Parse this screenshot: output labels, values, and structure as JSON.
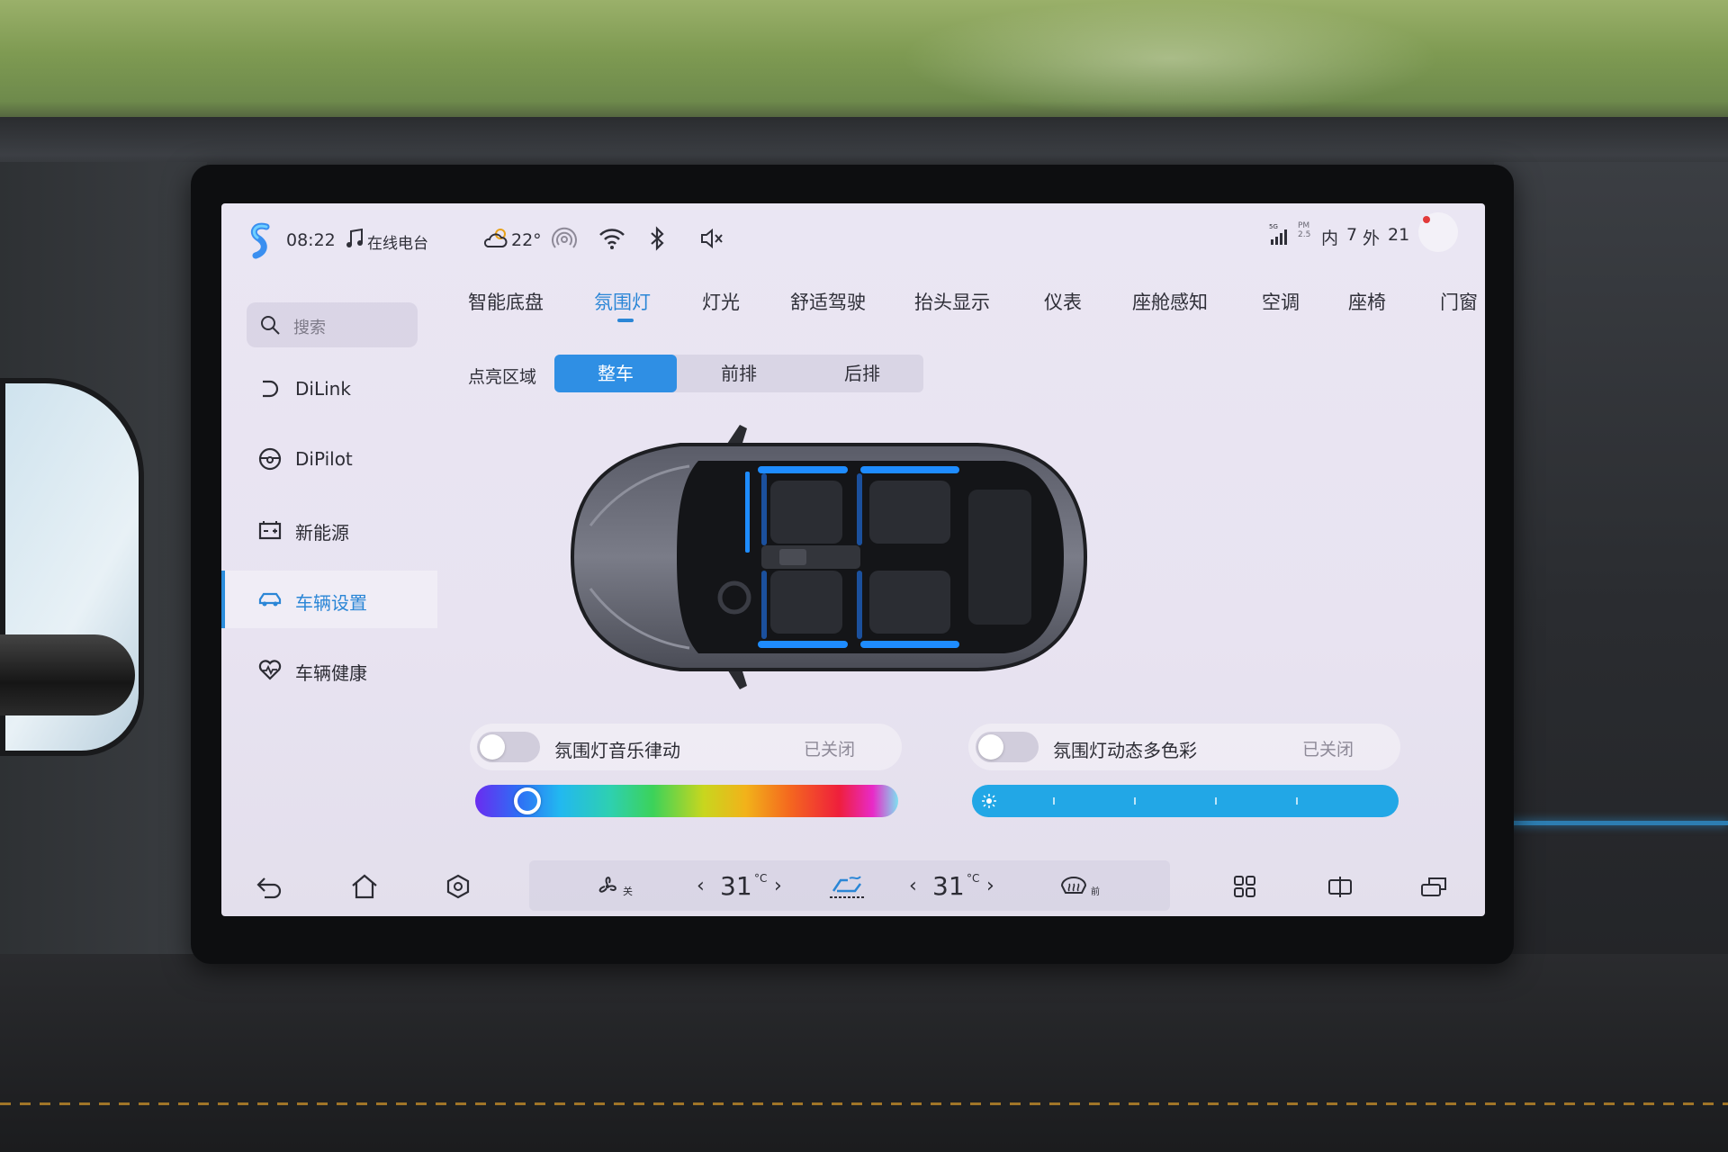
{
  "status_bar": {
    "time": "08:22",
    "radio": "在线电台",
    "weather_temp": "22°",
    "signal": "5G",
    "pm_label": "PM 2.5",
    "pm_inside_label": "内",
    "pm_inside_value": "7",
    "pm_outside_label": "外",
    "pm_outside_value": "21"
  },
  "sidebar": {
    "search_placeholder": "搜索",
    "items": [
      {
        "label": "DiLink",
        "icon": "dilink-icon"
      },
      {
        "label": "DiPilot",
        "icon": "steering-wheel-icon"
      },
      {
        "label": "新能源",
        "icon": "battery-icon"
      },
      {
        "label": "车辆设置",
        "icon": "car-icon",
        "active": true
      },
      {
        "label": "车辆健康",
        "icon": "heart-pulse-icon"
      }
    ]
  },
  "tabs": [
    {
      "label": "智能底盘"
    },
    {
      "label": "氛围灯",
      "active": true
    },
    {
      "label": "灯光"
    },
    {
      "label": "舒适驾驶"
    },
    {
      "label": "抬头显示"
    },
    {
      "label": "仪表"
    },
    {
      "label": "座舱感知"
    },
    {
      "label": "空调"
    },
    {
      "label": "座椅"
    },
    {
      "label": "门窗"
    }
  ],
  "zone": {
    "label": "点亮区域",
    "options": [
      "整车",
      "前排",
      "后排"
    ],
    "selected": "整车"
  },
  "toggles": [
    {
      "label": "氛围灯音乐律动",
      "state": "已关闭",
      "on": false
    },
    {
      "label": "氛围灯动态多色彩",
      "state": "已关闭",
      "on": false
    }
  ],
  "sliders": {
    "color_position": 0.1,
    "brightness": 1.0
  },
  "dock": {
    "fan_state": "关",
    "driver_temp": "31",
    "passenger_temp": "31",
    "temp_unit": "°C",
    "defrost_label": "前"
  },
  "colors": {
    "accent": "#2b86d6",
    "segment_active": "#2f8fe4",
    "brightness_bar": "#22a7e6",
    "ambient_light": "#1e8cff"
  }
}
